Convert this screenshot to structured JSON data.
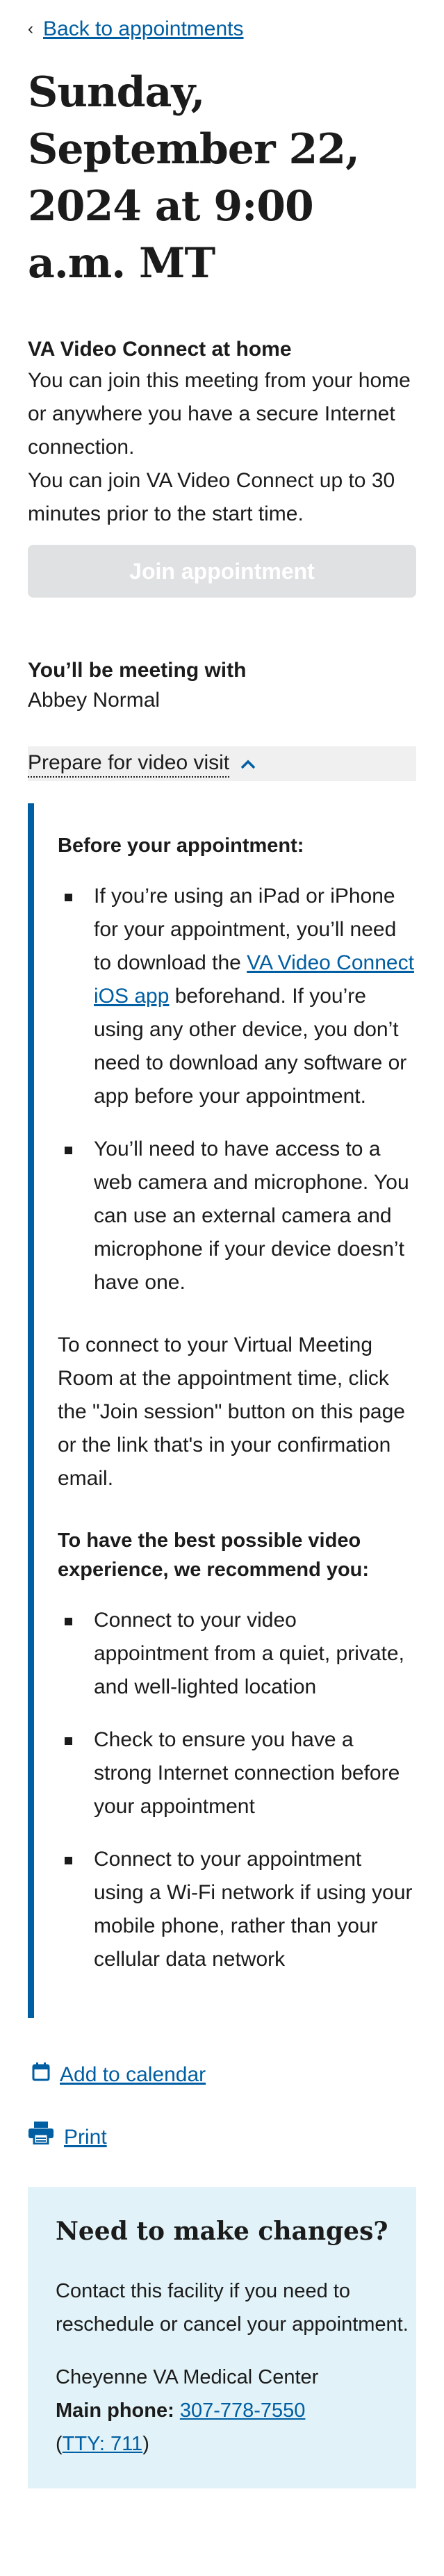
{
  "nav": {
    "back_label": "Back to appointments"
  },
  "appointment": {
    "title": "Sunday, September 22, 2024 at 9:00 a.m. MT",
    "kind": "VA Video Connect at home",
    "desc1": "You can join this meeting from your home or anywhere you have a secure Internet connection.",
    "desc2": "You can join VA Video Connect up to 30 minutes prior to the start time.",
    "join_label": "Join appointment"
  },
  "meeting": {
    "heading": "You’ll be meeting with",
    "name": "Abbey Normal"
  },
  "prepare": {
    "toggle_label": "Prepare for video visit",
    "before_heading": "Before your appointment:",
    "before_item1_pre": "If you’re using an iPad or iPhone for your appointment, you’ll need to download the ",
    "before_item1_link": "VA Video Connect iOS app",
    "before_item1_post": " beforehand. If you’re using any other device, you don’t need to download any software or app before your appointment.",
    "before_item2": "You’ll need to have access to a web camera and microphone. You can use an external camera and microphone if your device doesn’t have one.",
    "connect_text": "To connect to your Virtual Meeting Room at the appointment time, click the \"Join session\" button on this page or the link that's in your confirmation email.",
    "best_heading": "To have the best possible video experience, we recommend you:",
    "best_items": [
      "Connect to your video appointment from a quiet, private, and well-lighted location",
      "Check to ensure you have a strong Internet connection before your appointment",
      "Connect to your appointment using a Wi-Fi network if using your mobile phone, rather than your cellular data network"
    ]
  },
  "actions": {
    "calendar_label": "Add to calendar",
    "print_label": "Print"
  },
  "changes": {
    "heading": "Need to make changes?",
    "text": "Contact this facility if you need to reschedule or cancel your appointment.",
    "facility_name": "Cheyenne VA Medical Center",
    "phone_label": "Main phone:",
    "phone_number": "307-778-7550",
    "tty_open": "(",
    "tty_label": "TTY: 711",
    "tty_close": ")"
  },
  "colors": {
    "link": "#005ea2",
    "accent_bar": "#005ea2",
    "disabled_button": "#dfe1e2",
    "changes_bg": "#e1f3f8"
  }
}
